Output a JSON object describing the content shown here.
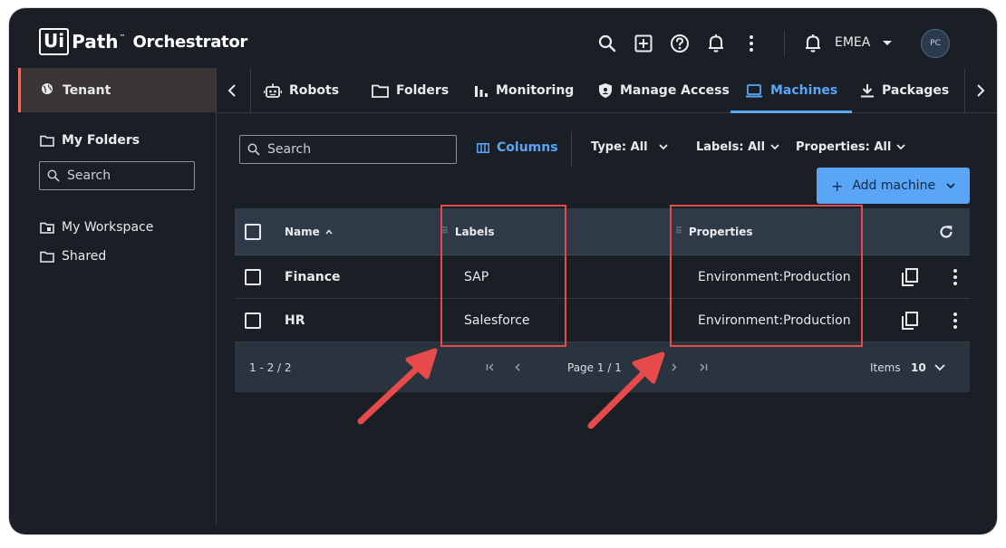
{
  "header": {
    "logo_box": "Ui",
    "logo_path": "Path",
    "logo_tm": "™",
    "product": "Orchestrator",
    "tenant": "EMEA",
    "avatar_initials": "PC"
  },
  "sidebar": {
    "tenant_label": "Tenant",
    "my_folders": "My Folders",
    "search_placeholder": "Search",
    "items": [
      {
        "label": "My Workspace",
        "icon": "folder-user-icon"
      },
      {
        "label": "Shared",
        "icon": "folder-icon"
      }
    ]
  },
  "tabs": [
    {
      "label": "Robots",
      "icon": "robot-icon"
    },
    {
      "label": "Folders",
      "icon": "folder-icon"
    },
    {
      "label": "Monitoring",
      "icon": "bar-chart-icon"
    },
    {
      "label": "Manage Access",
      "icon": "shield-icon"
    },
    {
      "label": "Machines",
      "icon": "laptop-icon",
      "active": true
    },
    {
      "label": "Packages",
      "icon": "download-icon"
    }
  ],
  "toolbar": {
    "search_placeholder": "Search",
    "columns_label": "Columns",
    "filters": [
      {
        "label": "Type: All"
      },
      {
        "label": "Labels: All"
      },
      {
        "label": "Properties: All"
      }
    ],
    "add_machine_label": "Add machine"
  },
  "table": {
    "headers": {
      "name": "Name",
      "labels": "Labels",
      "properties": "Properties"
    },
    "rows": [
      {
        "name": "Finance",
        "labels": "SAP",
        "properties": "Environment:Production"
      },
      {
        "name": "HR",
        "labels": "Salesforce",
        "properties": "Environment:Production"
      }
    ],
    "footer": {
      "range": "1 - 2 / 2",
      "page": "Page 1 / 1",
      "items_label": "Items",
      "items_per_page": "10"
    }
  },
  "colors": {
    "accent": "#5aa5f5",
    "background": "#1a1f26",
    "header_row": "#2e3a46",
    "annotation": "#e64a4a"
  }
}
